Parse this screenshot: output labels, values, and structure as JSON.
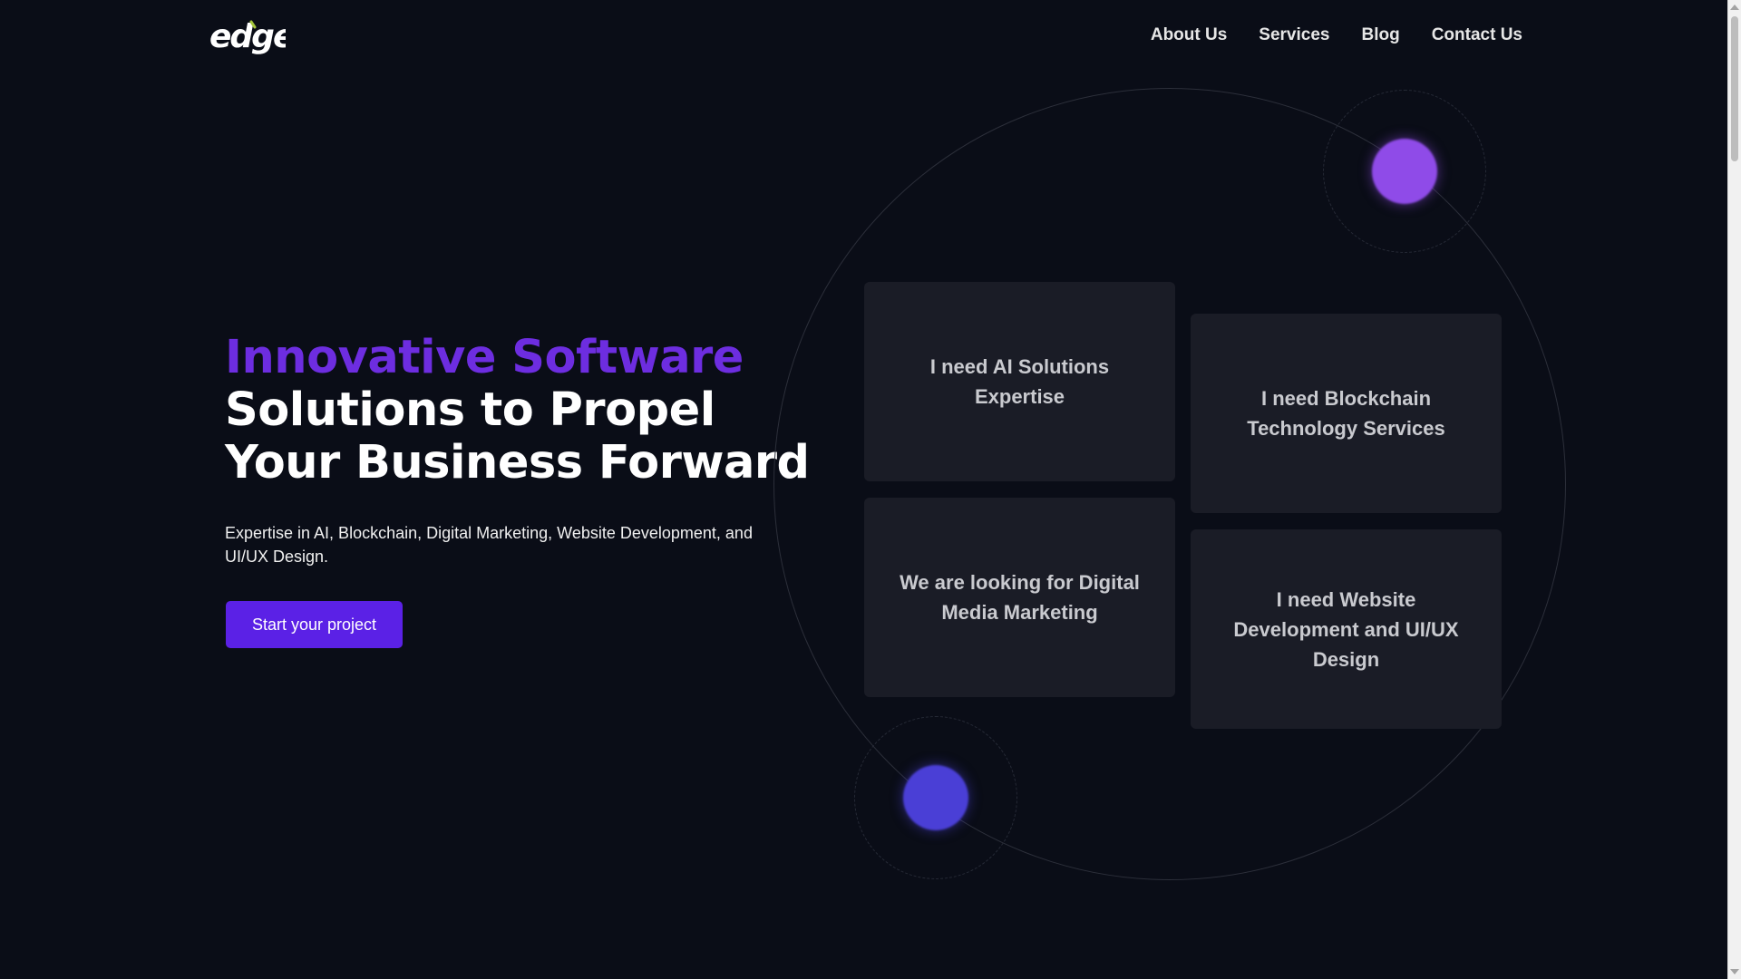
{
  "header": {
    "logo_text": "edge",
    "nav": [
      {
        "label": "About Us"
      },
      {
        "label": "Services"
      },
      {
        "label": "Blog"
      },
      {
        "label": "Contact Us"
      }
    ]
  },
  "hero": {
    "title_accent": "Innovative Software",
    "title_rest": "Solutions to Propel Your Business Forward",
    "subtitle": "Expertise in AI, Blockchain, Digital Marketing, Website Development, and UI/UX Design.",
    "cta_label": "Start your project"
  },
  "cards": [
    {
      "label": "I need AI Solutions Expertise"
    },
    {
      "label": "I need Blockchain Technology Services"
    },
    {
      "label": "We are looking for Digital Media Marketing"
    },
    {
      "label": "I need Website Development and UI/UX Design"
    }
  ],
  "colors": {
    "background": "#0a0d17",
    "accent_purple": "#6d2de0",
    "cta": "#5b21e6",
    "card": "#1a1c26",
    "dot_purple": "#8f4be8",
    "dot_blue": "#4a3fd6"
  }
}
